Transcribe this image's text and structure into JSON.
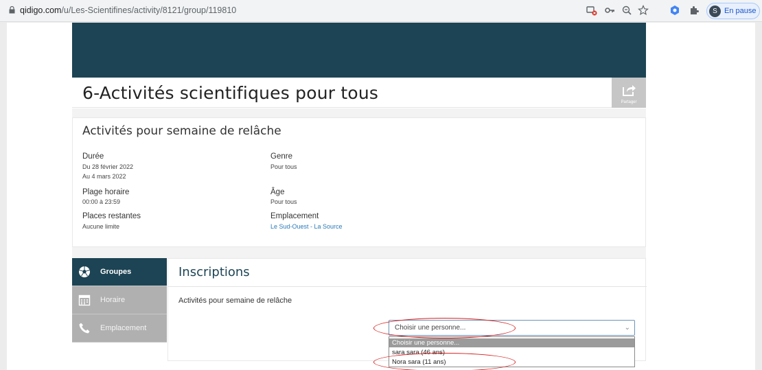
{
  "browser": {
    "url_host": "qidigo.com",
    "url_path": "/u/Les-Scientifines/activity/8121/group/119810",
    "profile_initial": "S",
    "profile_label": "En pause"
  },
  "page": {
    "title": "6-Activités scientifiques pour tous",
    "share_label": "Partager"
  },
  "info": {
    "title": "Activités pour semaine de relâche",
    "duree": {
      "label": "Durée",
      "line1": "Du 28 février 2022",
      "line2": "Au 4 mars 2022"
    },
    "genre": {
      "label": "Genre",
      "value": "Pour tous"
    },
    "plage": {
      "label": "Plage horaire",
      "value": "00:00 à 23:59"
    },
    "age": {
      "label": "Âge",
      "value": "Pour tous"
    },
    "places": {
      "label": "Places restantes",
      "value": "Aucune limite"
    },
    "emplacement": {
      "label": "Emplacement",
      "value": "Le Sud-Ouest - La Source"
    }
  },
  "tabs": [
    {
      "label": "Groupes",
      "icon": "soccer-ball-icon",
      "active": true
    },
    {
      "label": "Horaire",
      "icon": "calendar-icon",
      "active": false
    },
    {
      "label": "Emplacement",
      "icon": "phone-icon",
      "active": false
    }
  ],
  "inscriptions": {
    "title": "Inscriptions",
    "subtitle": "Activités pour semaine de relâche",
    "select": {
      "value": "Choisir une personne...",
      "options": [
        "Choisir une personne...",
        "sara sara (46 ans)",
        "Nora sara (11 ans)"
      ]
    }
  },
  "colors": {
    "brand_dark": "#1d4454",
    "annotation_red": "#d82020",
    "link": "#2a7ab8"
  }
}
